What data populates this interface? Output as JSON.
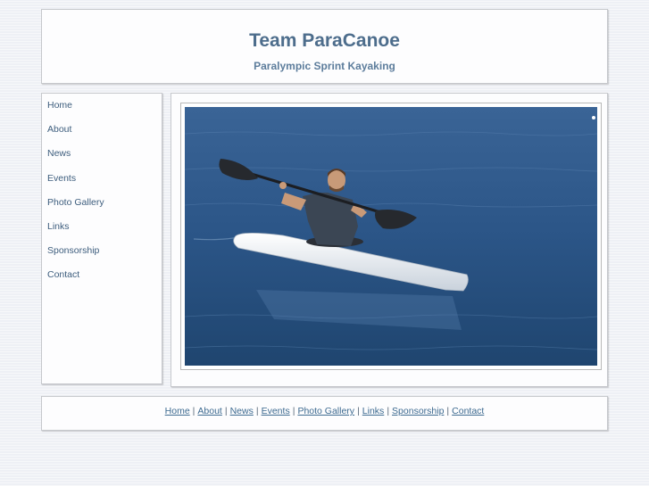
{
  "header": {
    "title": "Team ParaCanoe",
    "subtitle": "Paralympic Sprint Kayaking"
  },
  "nav": [
    {
      "label": "Home"
    },
    {
      "label": "About"
    },
    {
      "label": "News"
    },
    {
      "label": "Events"
    },
    {
      "label": "Photo Gallery"
    },
    {
      "label": "Links"
    },
    {
      "label": "Sponsorship"
    },
    {
      "label": "Contact"
    }
  ],
  "footer": {
    "separator": "|",
    "links": [
      {
        "label": "Home"
      },
      {
        "label": "About"
      },
      {
        "label": "News"
      },
      {
        "label": "Events"
      },
      {
        "label": "Photo Gallery"
      },
      {
        "label": "Links"
      },
      {
        "label": "Sponsorship"
      },
      {
        "label": "Contact"
      }
    ]
  },
  "colors": {
    "accent": "#4d6d8c",
    "link": "#3d6a90",
    "page_background": "#eef0f5",
    "water": "#2f5a8c"
  }
}
